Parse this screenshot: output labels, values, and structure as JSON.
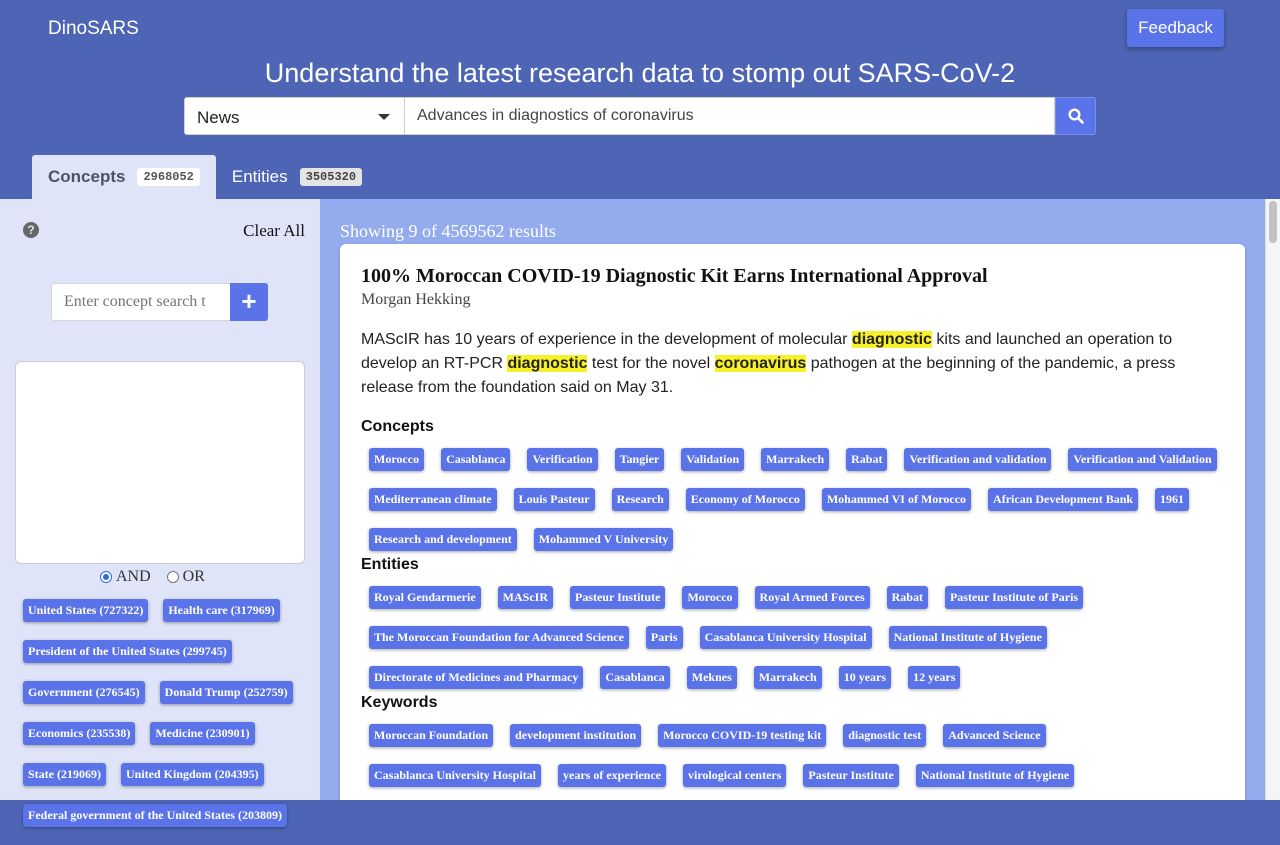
{
  "app": {
    "brand": "DinoSARS",
    "feedback_label": "Feedback"
  },
  "header": {
    "headline": "Understand the latest research data to stomp out SARS-CoV-2",
    "search": {
      "category": "News",
      "query": "Advances in diagnostics of coronavirus"
    }
  },
  "tabs": [
    {
      "label": "Concepts",
      "count": "2968052"
    },
    {
      "label": "Entities",
      "count": "3505320"
    }
  ],
  "sidebar": {
    "help_icon": "?",
    "clear_all": "Clear All",
    "concept_placeholder": "Enter concept search t",
    "add_label": "+",
    "logic": {
      "and": "AND",
      "or": "OR",
      "selected": "AND"
    },
    "facets": [
      "United States (727322)",
      "Health care (317969)",
      "President of the United States (299745)",
      "Government (276545)",
      "Donald Trump (252759)",
      "Economics (235538)",
      "Medicine (230901)",
      "State (219069)",
      "United Kingdom (204395)",
      "Federal government of the United States (203809)"
    ]
  },
  "main": {
    "results_text": "Showing 9 of 4569562 results",
    "article": {
      "title": "100% Moroccan COVID-19 Diagnostic Kit Earns International Approval",
      "author": "Morgan Hekking",
      "body": [
        {
          "t": "MAScIR has 10 years of experience in the development of molecular ",
          "hl": false
        },
        {
          "t": "diagnostic",
          "hl": true
        },
        {
          "t": " kits and launched an operation to develop an RT-PCR ",
          "hl": false
        },
        {
          "t": "diagnostic",
          "hl": true
        },
        {
          "t": " test for the novel ",
          "hl": false
        },
        {
          "t": "coronavirus",
          "hl": true
        },
        {
          "t": " pathogen at the beginning of the pandemic, a press release from the foundation said on May 31.",
          "hl": false
        }
      ],
      "concepts_label": "Concepts",
      "concepts": [
        "Morocco",
        "Casablanca",
        "Verification",
        "Tangier",
        "Validation",
        "Marrakech",
        "Rabat",
        "Verification and validation",
        "Verification and Validation",
        "Mediterranean climate",
        "Louis Pasteur",
        "Research",
        "Economy of Morocco",
        "Mohammed VI of Morocco",
        "African Development Bank",
        "1961",
        "Research and development",
        "Mohammed V University"
      ],
      "entities_label": "Entities",
      "entities": [
        "Royal Gendarmerie",
        "MAScIR",
        "Pasteur Institute",
        "Morocco",
        "Royal Armed Forces",
        "Rabat",
        "Pasteur Institute of Paris",
        "The Moroccan Foundation for Advanced Science",
        "Paris",
        "Casablanca University Hospital",
        "National Institute of Hygiene",
        "Directorate of Medicines and Pharmacy",
        "Casablanca",
        "Meknes",
        "Marrakech",
        "10 years",
        "12 years"
      ],
      "keywords_label": "Keywords",
      "keywords": [
        "Moroccan Foundation",
        "development institution",
        "Morocco COVID-19 testing kit",
        "diagnostic test",
        "Advanced Science",
        "Casablanca University Hospital",
        "years of experience",
        "virological centers",
        "Pasteur Institute",
        "National Institute of Hygiene"
      ]
    }
  }
}
